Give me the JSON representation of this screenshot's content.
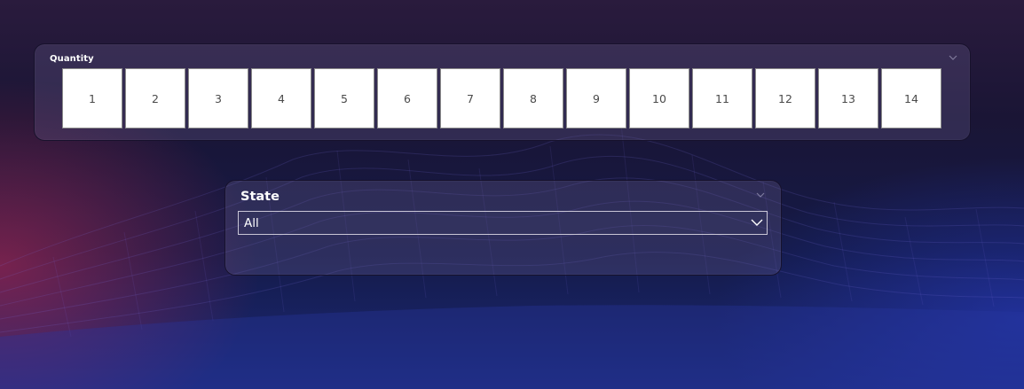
{
  "quantity_slicer": {
    "title": "Quantity",
    "options": [
      "1",
      "2",
      "3",
      "4",
      "5",
      "6",
      "7",
      "8",
      "9",
      "10",
      "11",
      "12",
      "13",
      "14"
    ]
  },
  "state_slicer": {
    "title": "State",
    "selected_value": "All"
  },
  "icons": {
    "panel_menu": "chevron-down-icon",
    "dropdown": "chevron-down-icon"
  },
  "colors": {
    "panel_bg": "#3c3658",
    "tile_bg": "#ffffff",
    "tile_text": "#4a4a4a",
    "title_text": "#ffffff"
  }
}
